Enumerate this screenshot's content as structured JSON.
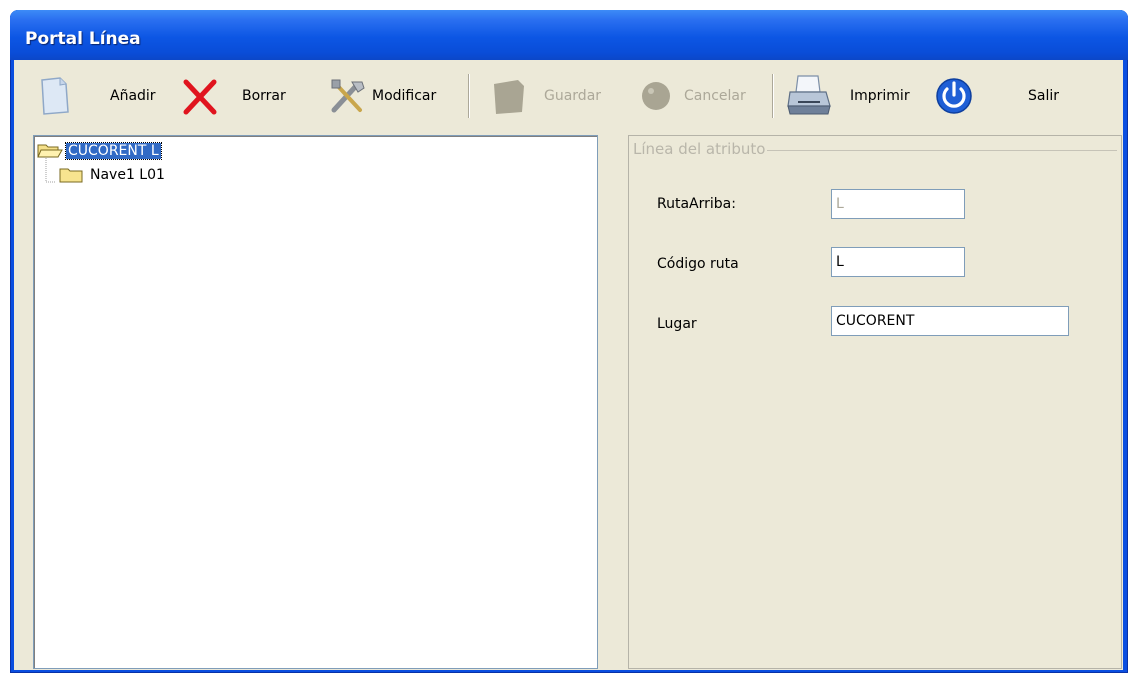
{
  "window": {
    "title": "Portal Línea"
  },
  "toolbar": {
    "add_label": "Añadir",
    "delete_label": "Borrar",
    "modify_label": "Modificar",
    "save_label": "Guardar",
    "cancel_label": "Cancelar",
    "print_label": "Imprimir",
    "exit_label": "Salir"
  },
  "tree": {
    "root": "CUCORENT L",
    "child": "Nave1 L01"
  },
  "form": {
    "group_title": "Línea del atributo",
    "ruta_arriba_label": "RutaArriba:",
    "ruta_arriba_value": "L",
    "codigo_ruta_label": "Código ruta",
    "codigo_ruta_value": "L",
    "lugar_label": "Lugar",
    "lugar_value": "CUCORENT"
  },
  "colors": {
    "titlebar": "#0a4ee0",
    "selection": "#316ac5",
    "face": "#ece9d8"
  }
}
